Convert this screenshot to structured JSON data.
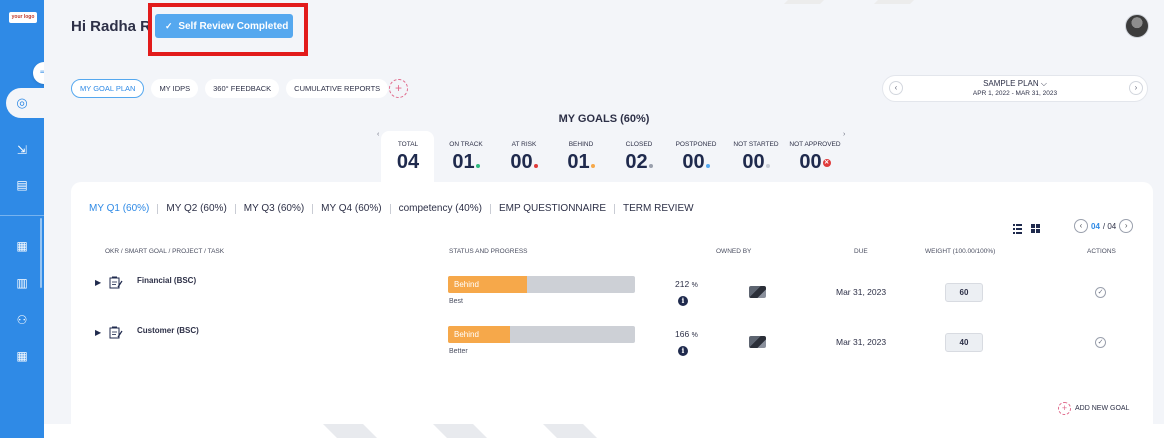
{
  "sidebar": {
    "logo_text": "your logo",
    "collapse_icon": "arrow-right-icon",
    "items": [
      {
        "icon": "target-icon",
        "glyph": "◎"
      },
      {
        "icon": "hierarchy-icon",
        "glyph": "⇲"
      },
      {
        "icon": "document-icon",
        "glyph": "▤"
      },
      {
        "icon": "chart-icon",
        "glyph": "▦"
      },
      {
        "icon": "book-icon",
        "glyph": "▥"
      },
      {
        "icon": "people-icon",
        "glyph": "⚇"
      },
      {
        "icon": "report-icon",
        "glyph": "▦"
      }
    ]
  },
  "header": {
    "greeting": "Hi Radha R",
    "review_button": "Self Review Completed",
    "review_check": "✓"
  },
  "top_tabs": [
    "MY GOAL PLAN",
    "MY IDPS",
    "360° FEEDBACK",
    "CUMULATIVE REPORTS"
  ],
  "add_tab": "+",
  "plan": {
    "name": "SAMPLE PLAN ⌵",
    "dates": "APR 1, 2022 - MAR 31, 2023",
    "prev": "‹",
    "next": "›"
  },
  "goals": {
    "title": "MY GOALS (60%)",
    "stats": [
      {
        "label": "TOTAL",
        "value": "04",
        "dot": ""
      },
      {
        "label": "ON TRACK",
        "value": "01",
        "dot": "#2db87d"
      },
      {
        "label": "AT RISK",
        "value": "00",
        "dot": "#e03b3b"
      },
      {
        "label": "BEHIND",
        "value": "01",
        "dot": "#f6a84a"
      },
      {
        "label": "CLOSED",
        "value": "02",
        "dot": "#9aa0ad"
      },
      {
        "label": "POSTPONED",
        "value": "00",
        "dot": "#55a8ef"
      },
      {
        "label": "NOT STARTED",
        "value": "00",
        "dot": "#c9ccd4"
      },
      {
        "label": "NOT APPROVED",
        "value": "00",
        "dot": "x"
      }
    ]
  },
  "quarter_tabs": [
    "MY Q1 (60%)",
    "MY Q2 (60%)",
    "MY Q3 (60%)",
    "MY Q4 (60%)",
    "competency (40%)",
    "EMP QUESTIONNAIRE",
    "TERM REVIEW"
  ],
  "pager": {
    "current": "04",
    "total": "/ 04",
    "prev": "‹",
    "next": "›"
  },
  "table": {
    "headers": [
      "OKR / SMART GOAL / PROJECT / TASK",
      "STATUS AND PROGRESS",
      "OWNED BY",
      "DUE",
      "WEIGHT (100.00/100%)",
      "ACTIONS"
    ],
    "rows": [
      {
        "title": "Financial (BSC)",
        "status": "Behind",
        "progress": 0.42,
        "sub": "Best",
        "percent": "212",
        "percent_unit": "%",
        "due": "Mar 31, 2023",
        "weight": "60",
        "action": "✓"
      },
      {
        "title": "Customer (BSC)",
        "status": "Behind",
        "progress": 0.33,
        "sub": "Better",
        "percent": "166",
        "percent_unit": "%",
        "due": "Mar 31, 2023",
        "weight": "40",
        "action": "✓"
      }
    ]
  },
  "add_goal": {
    "icon": "+",
    "label": "ADD NEW GOAL"
  },
  "colors": {
    "sidebar": "#2f8ae6",
    "accent": "#55a8ef",
    "behind": "#f6a84a",
    "highlight": "#e21b1b"
  }
}
